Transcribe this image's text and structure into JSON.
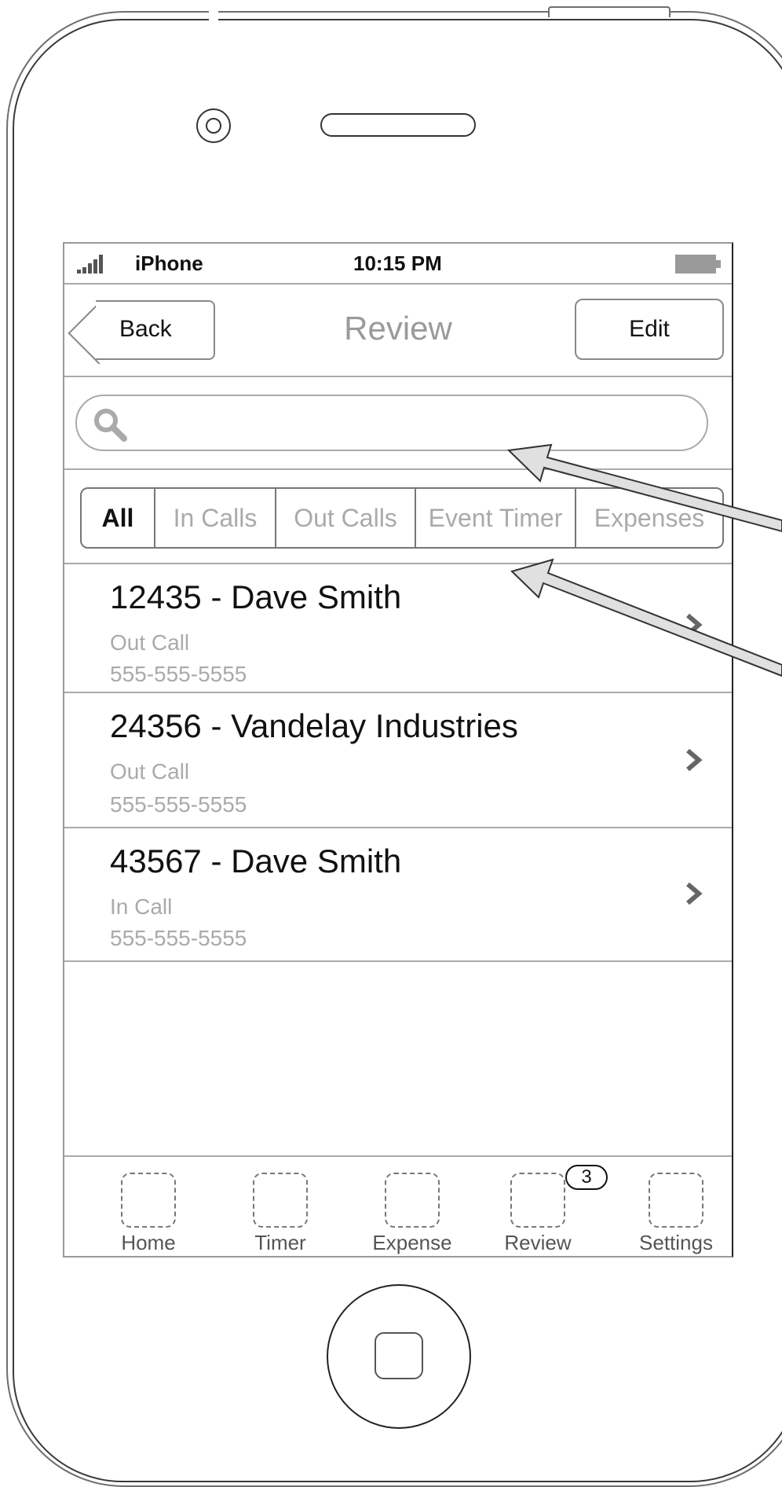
{
  "status_bar": {
    "carrier": "iPhone",
    "time": "10:15 PM"
  },
  "nav": {
    "back_label": "Back",
    "title": "Review",
    "edit_label": "Edit"
  },
  "search": {
    "placeholder": ""
  },
  "segments": [
    {
      "label": "All",
      "active": true
    },
    {
      "label": "In Calls",
      "active": false
    },
    {
      "label": "Out Calls",
      "active": false
    },
    {
      "label": "Event Timer",
      "active": false
    },
    {
      "label": "Expenses",
      "active": false
    }
  ],
  "list": [
    {
      "title": "12435 - Dave Smith",
      "type": "Out Call",
      "phone": "555-555-5555"
    },
    {
      "title": "24356 - Vandelay Industries",
      "type": "Out Call",
      "phone": "555-555-5555"
    },
    {
      "title": "43567 - Dave Smith",
      "type": "In Call",
      "phone": "555-555-5555"
    }
  ],
  "tabs": [
    {
      "label": "Home"
    },
    {
      "label": "Timer"
    },
    {
      "label": "Expense"
    },
    {
      "label": "Review",
      "badge": "3"
    },
    {
      "label": "Settings"
    }
  ]
}
